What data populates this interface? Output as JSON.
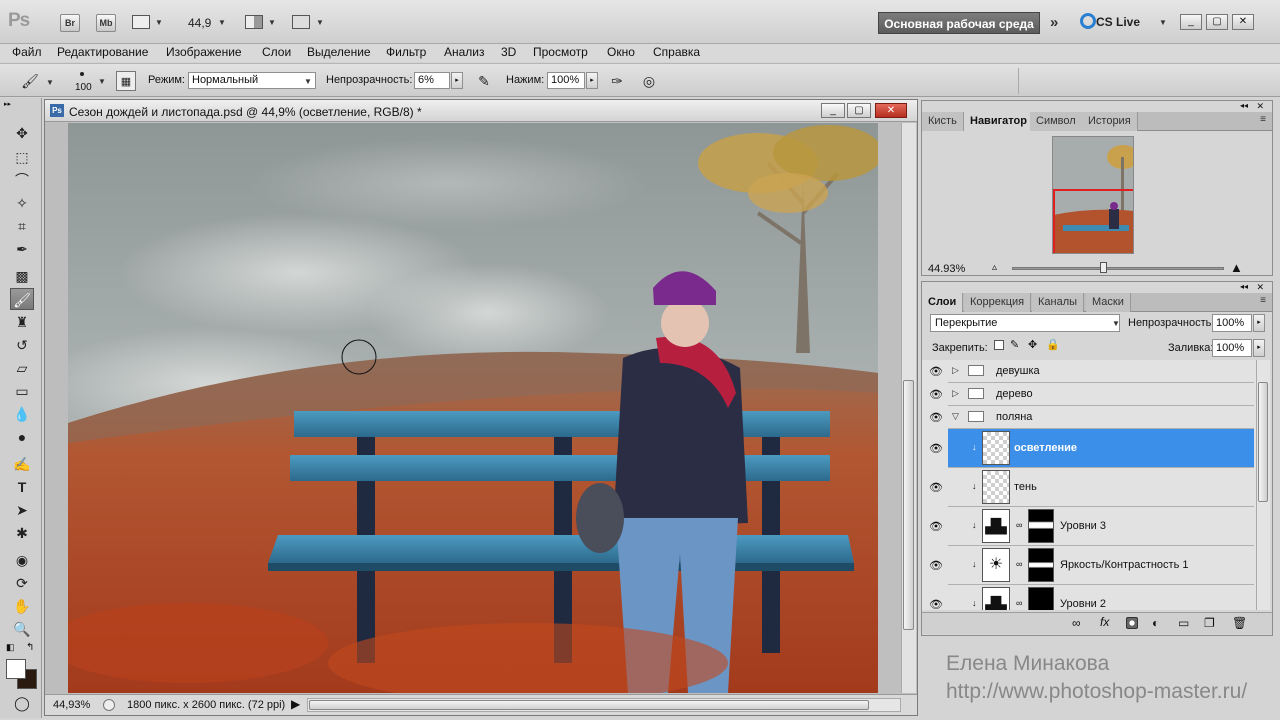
{
  "app": {
    "logo": "Ps",
    "bridge": "Br",
    "minibridge": "Mb",
    "zoom": "44,9",
    "workspace": "Основная рабочая среда",
    "cslive": "CS Live"
  },
  "menu": [
    "Файл",
    "Редактирование",
    "Изображение",
    "Слои",
    "Выделение",
    "Фильтр",
    "Анализ",
    "3D",
    "Просмотр",
    "Окно",
    "Справка"
  ],
  "options": {
    "brush_size": "100",
    "mode_label": "Режим:",
    "mode_value": "Нормальный",
    "opacity_label": "Непрозрачность:",
    "opacity_value": "6%",
    "flow_label": "Нажим:",
    "flow_value": "100%"
  },
  "document": {
    "title": "Сезон дождей и листопада.psd @ 44,9% (осветление, RGB/8) *",
    "status_zoom": "44,93%",
    "status_info": "1800 пикс. x 2600 пикс. (72 ppi)"
  },
  "navigator": {
    "tabs": [
      "Кисть",
      "Навигатор",
      "Символ",
      "История"
    ],
    "active_tab": "Навигатор",
    "zoom": "44.93%"
  },
  "layers": {
    "tabs": [
      "Слои",
      "Коррекция",
      "Каналы",
      "Маски"
    ],
    "active_tab": "Слои",
    "blend_mode": "Перекрытие",
    "opacity_label": "Непрозрачность:",
    "opacity_value": "100%",
    "lock_label": "Закрепить:",
    "fill_label": "Заливка:",
    "fill_value": "100%",
    "items": [
      {
        "name": "девушка",
        "type": "group"
      },
      {
        "name": "дерево",
        "type": "group"
      },
      {
        "name": "поляна",
        "type": "group-open"
      },
      {
        "name": "осветление",
        "type": "layer",
        "selected": true
      },
      {
        "name": "тень",
        "type": "layer"
      },
      {
        "name": "Уровни 3",
        "type": "adjustment"
      },
      {
        "name": "Яркость/Контрастность 1",
        "type": "adjustment"
      },
      {
        "name": "Уровни 2",
        "type": "adjustment"
      }
    ]
  },
  "watermark": {
    "author": "Елена Минакова",
    "url": "http://www.photoshop-master.ru/"
  }
}
